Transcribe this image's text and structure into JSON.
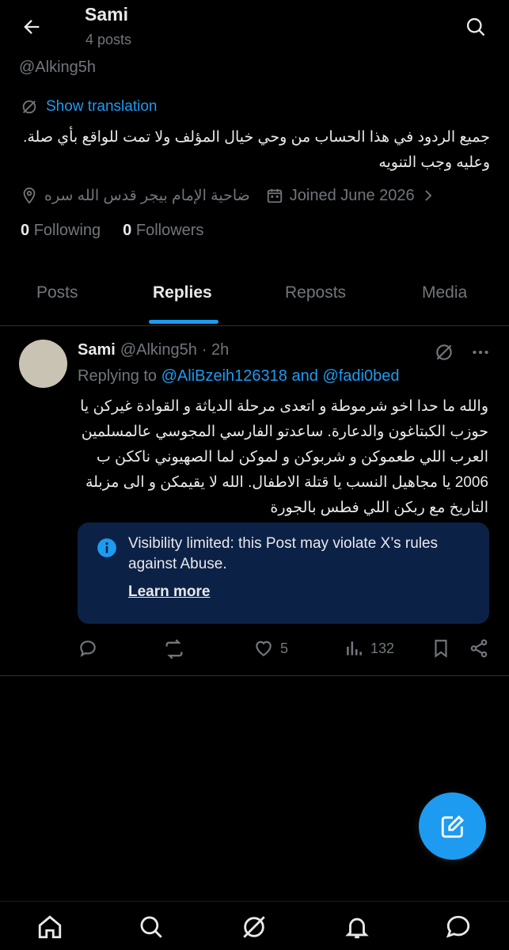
{
  "header": {
    "title": "Sami",
    "subtitle": "4 posts"
  },
  "profile": {
    "handle": "@Alking5h",
    "translate_label": "Show translation",
    "bio": "جميع الردود في هذا الحساب من وحي خيال المؤلف ولا تمت للواقع بأي صلة. وعليه وجب التنويه",
    "location": "ضاحية الإمام بيجر قدس الله سره",
    "joined": "Joined June 2026",
    "following_count": "0",
    "following_label": "Following",
    "followers_count": "0",
    "followers_label": "Followers"
  },
  "tabs": [
    {
      "label": "Posts"
    },
    {
      "label": "Replies"
    },
    {
      "label": "Reposts"
    },
    {
      "label": "Media"
    }
  ],
  "post": {
    "author_name": "Sami",
    "author_handle": "@Alking5h",
    "time": "· 2h",
    "replying_prefix": "Replying to",
    "reply_to_1": "@AliBzeih126318",
    "reply_and": "and",
    "reply_to_2": "@fadi0bed",
    "body": "والله ما حدا اخو شرموطة و اتعدى مرحلة الدياثة و القوادة غيركن يا حوزب الكبتاغون والدعارة. ساعدتو الفارسي المجوسي عالمسلمين العرب اللي طعموكن و شربوكن و لموكن لما الصهيوني ناككن ب 2006 يا مجاهيل النسب يا قتلة الاطفال. الله لا يقيمكن و الى مزبلة التاريخ مع ربكن اللي فطس بالجورة",
    "notice_text": "Visibility limited: this Post may violate X’s rules against Abuse.",
    "notice_link": "Learn more",
    "likes": "5",
    "views": "132"
  },
  "colors": {
    "accent": "#1d9bf0",
    "muted": "#71767b",
    "text": "#e7e9ea",
    "notice_bg": "#0c2146"
  }
}
